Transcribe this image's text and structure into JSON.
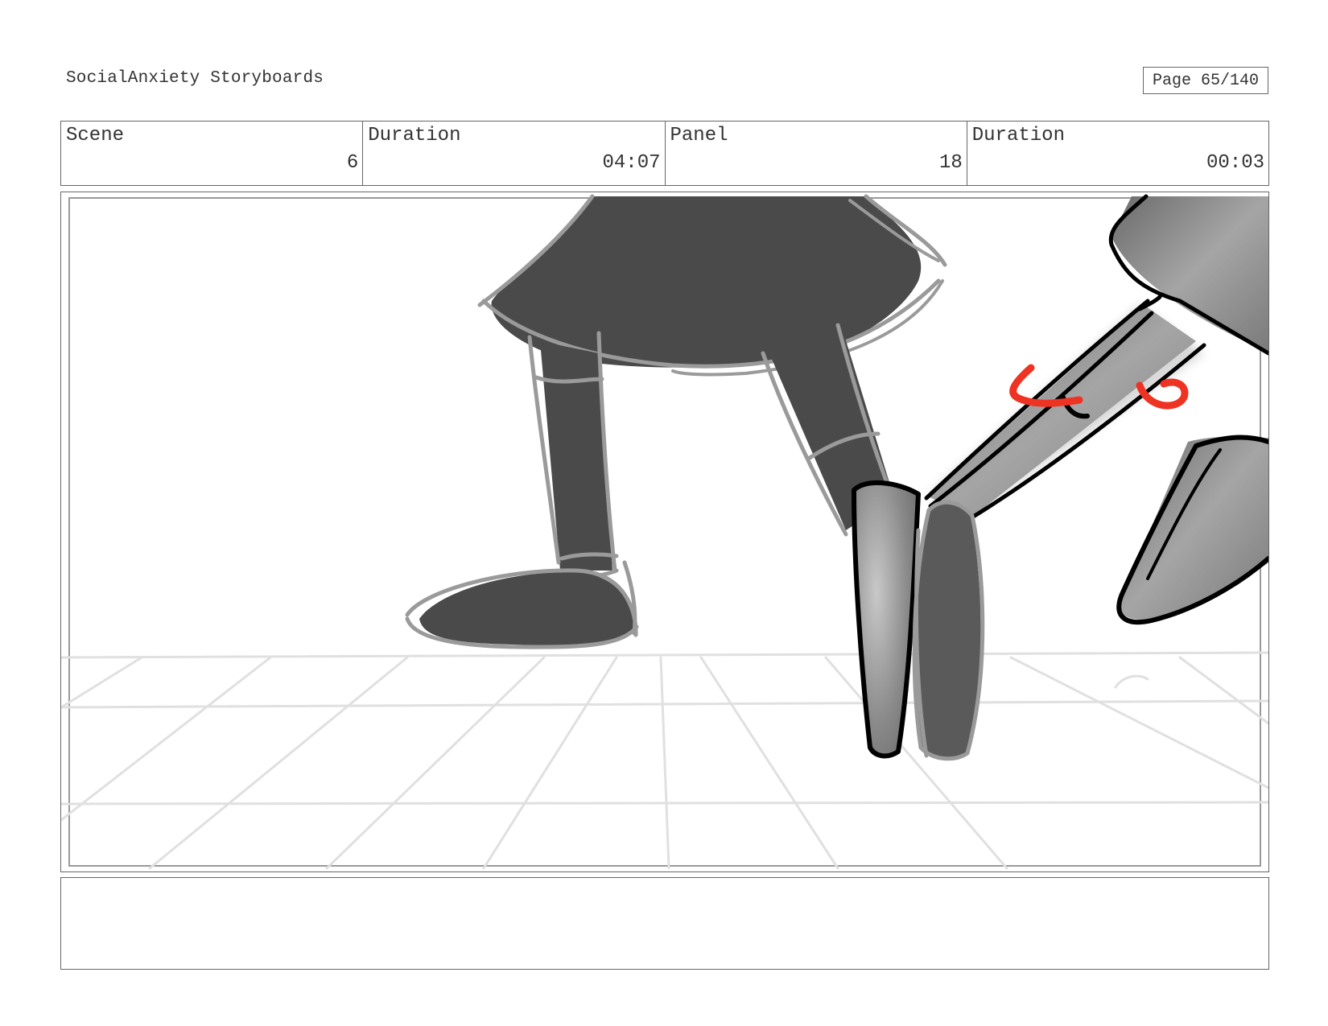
{
  "header": {
    "title": "SocialAnxiety Storyboards",
    "page_label": "Page",
    "page_value": "65/140"
  },
  "info": {
    "scene_label": "Scene",
    "scene_value": "6",
    "scene_duration_label": "Duration",
    "scene_duration_value": "04:07",
    "panel_label": "Panel",
    "panel_value": "18",
    "panel_duration_label": "Duration",
    "panel_duration_value": "00:03"
  },
  "colors": {
    "frame_border": "#666666",
    "sketch_dark": "#4a4a4a",
    "sketch_outline_gray": "#999999",
    "sketch_black": "#000000",
    "accent_red": "#ee3322",
    "floor_grid": "#e0e0e0"
  }
}
